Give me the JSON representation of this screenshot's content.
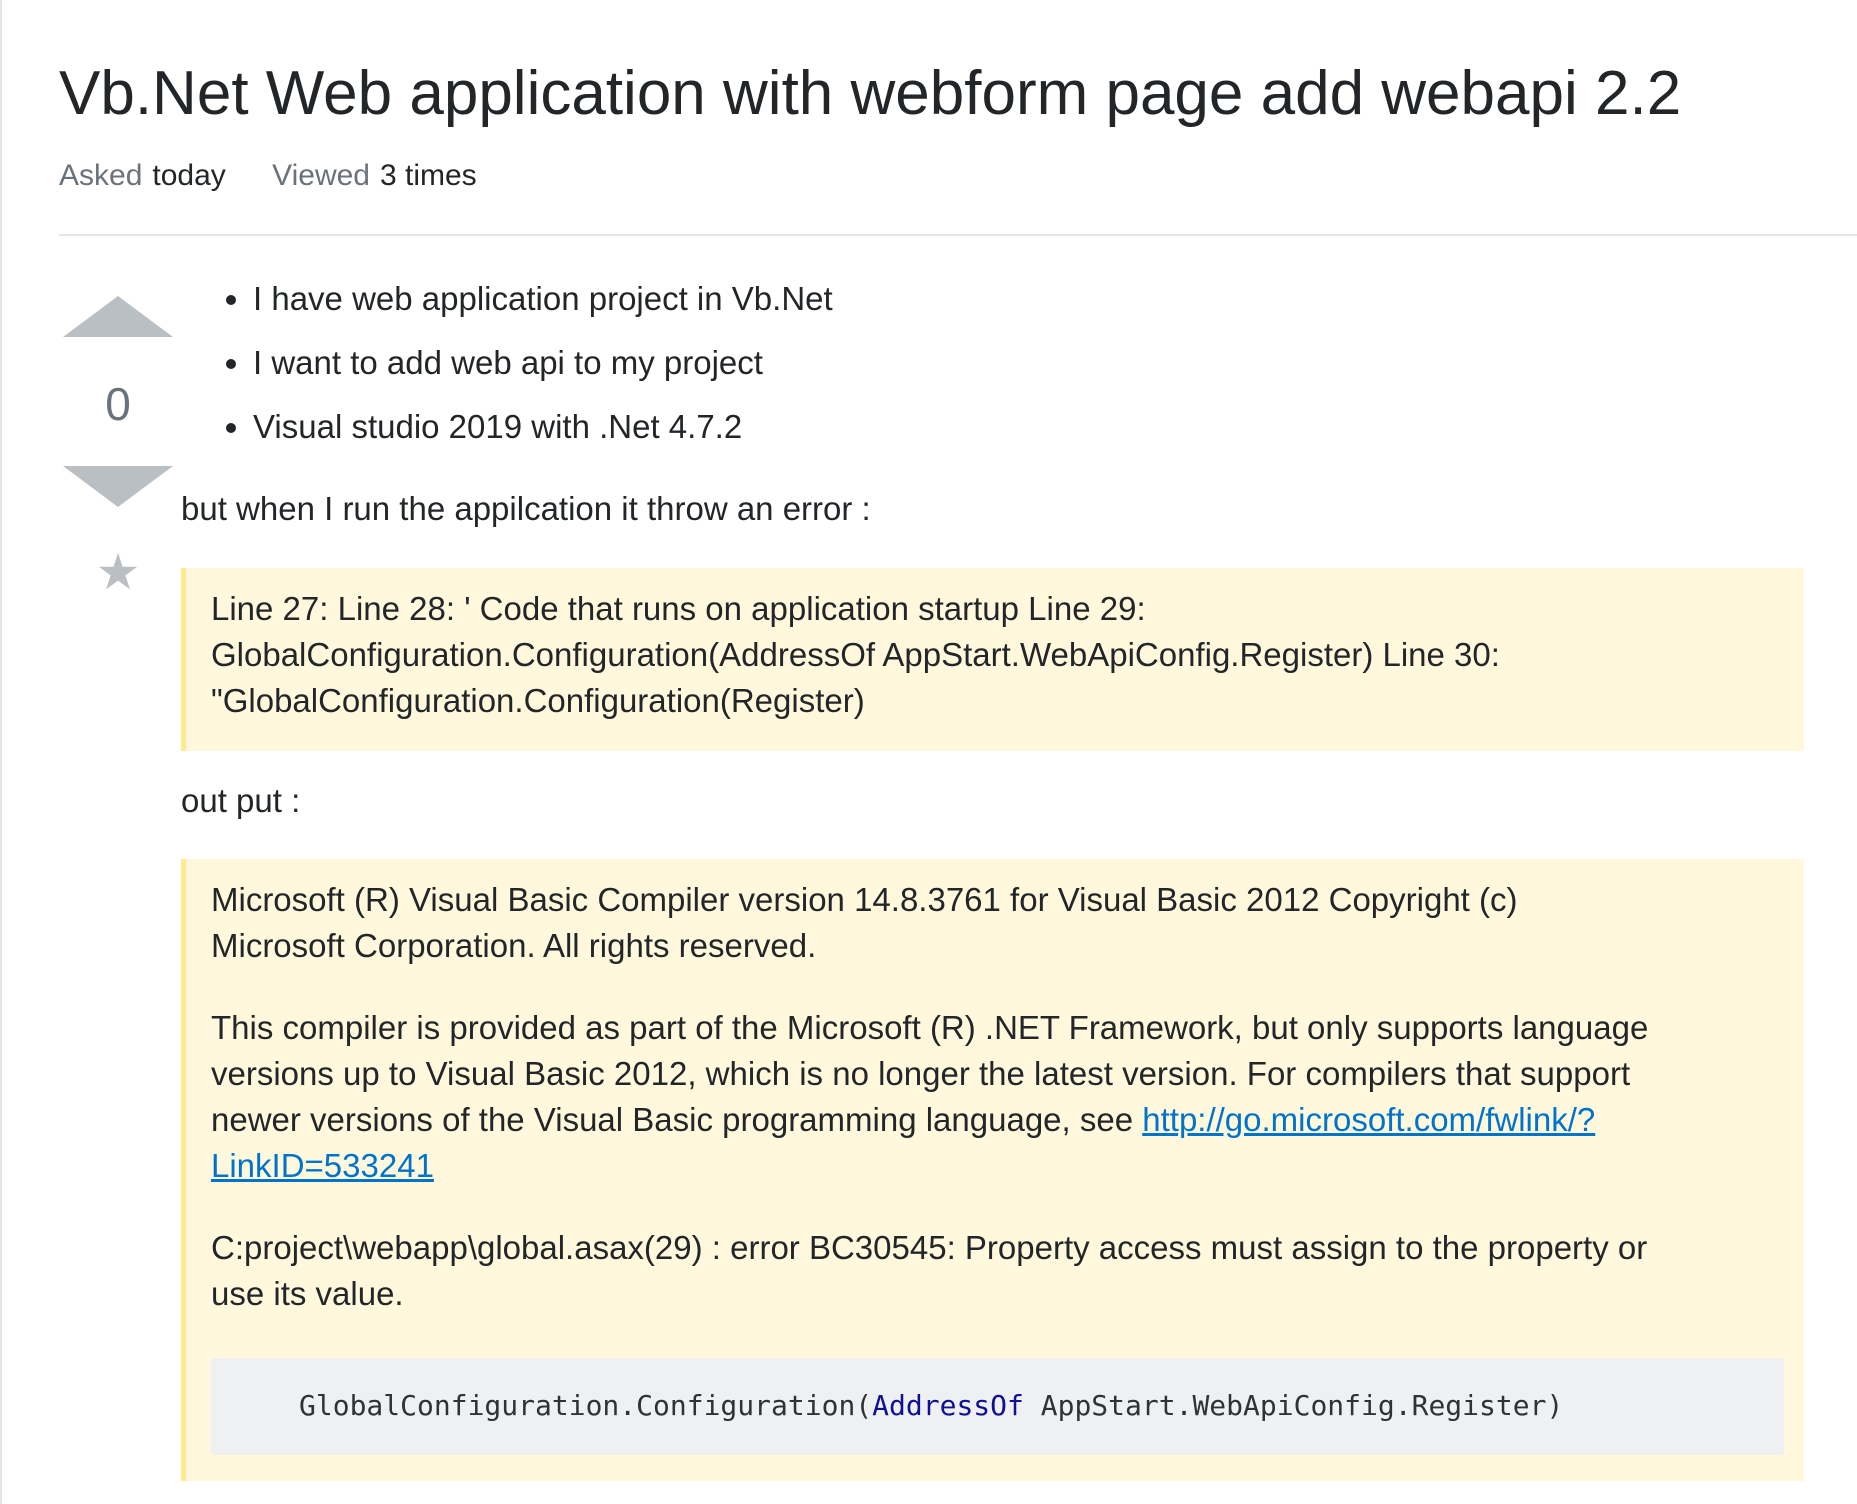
{
  "question": {
    "title": "Vb.Net Web application with webform page add webapi 2.2",
    "asked_label": "Asked",
    "asked_value": "today",
    "viewed_label": "Viewed",
    "viewed_value": "3 times"
  },
  "vote": {
    "count": "0",
    "up_icon": "arrow-up-icon",
    "down_icon": "arrow-down-icon",
    "bookmark_glyph": "★"
  },
  "post": {
    "bullets": [
      "I have web application project in Vb.Net",
      "I want to add web api to my project",
      "Visual studio 2019 with .Net 4.7.2"
    ],
    "intro_error": "but when I run the appilcation it throw an error :",
    "quote1_lines": [
      "Line 27: Line 28: ' Code that runs on application startup Line 29:",
      "GlobalConfiguration.Configuration(AddressOf AppStart.WebApiConfig.Register) Line 30:",
      "\"GlobalConfiguration.Configuration(Register)"
    ],
    "intro_output": "out put :",
    "quote2": {
      "p1_line1": "Microsoft (R) Visual Basic Compiler version 14.8.3761 for Visual Basic 2012 Copyright (c)",
      "p1_line2": "Microsoft Corporation. All rights reserved.",
      "p2_line1": "This compiler is provided as part of the Microsoft (R) .NET Framework, but only supports language",
      "p2_line2": "versions up to Visual Basic 2012, which is no longer the latest version. For compilers that support",
      "p2_line3_prefix": "newer versions of the Visual Basic programming language, see ",
      "link_part1": "http://go.microsoft.com/fwlink/?",
      "link_part2": "LinkID=533241",
      "p3_line1": "C:project\\webapp\\global.asax(29) : error BC30545: Property access must assign to the property or",
      "p3_line2": "use its value.",
      "code_prefix": "GlobalConfiguration.Configuration(",
      "code_keyword": "AddressOf",
      "code_suffix": " AppStart.WebApiConfig.Register)"
    }
  },
  "colors": {
    "text": "#232629",
    "muted": "#6a737c",
    "vote_arrow": "#babfc4",
    "quote_bg": "#fff8dc",
    "quote_border": "#ffeb8e",
    "link": "#0074cc",
    "code_bg": "#eff0f1",
    "code_keyword": "#101094"
  }
}
